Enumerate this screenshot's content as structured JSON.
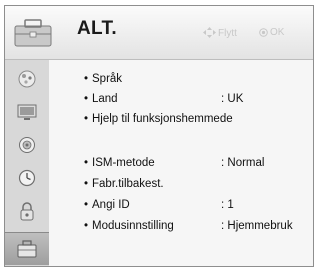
{
  "header": {
    "title": "ALT.",
    "hint_move": "Flytt",
    "hint_ok": "OK"
  },
  "sidebar": {
    "items": [
      {
        "icon": "picture-icon"
      },
      {
        "icon": "screen-icon"
      },
      {
        "icon": "audio-icon"
      },
      {
        "icon": "clock-icon"
      },
      {
        "icon": "lock-icon"
      },
      {
        "icon": "options-icon",
        "selected": true
      }
    ]
  },
  "options": [
    {
      "label": "Språk",
      "value": ""
    },
    {
      "label": "Land",
      "value": ": UK"
    },
    {
      "label": "Hjelp til funksjonshemmede",
      "value": ""
    },
    {
      "label": "ISM-metode",
      "value": ": Normal"
    },
    {
      "label": "Fabr.tilbakest.",
      "value": ""
    },
    {
      "label": "Angi ID",
      "value": ": 1"
    },
    {
      "label": "Modusinnstilling",
      "value": ": Hjemmebruk"
    }
  ],
  "bullet": "•",
  "colors": {
    "panel_bg": "#f5f5f5",
    "sidebar_bg": "#d8d8d8",
    "hint_text": "#c8c8c8"
  }
}
